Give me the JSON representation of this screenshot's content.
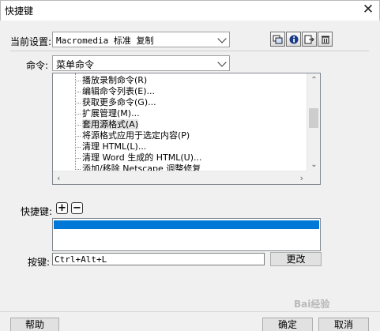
{
  "window": {
    "title": "快捷键",
    "close_glyph": "✕"
  },
  "current_set": {
    "label": "当前设置:",
    "value": "Macromedia 标准 复制"
  },
  "toolbar_icons": [
    "duplicate-set-icon",
    "info-icon",
    "export-html-icon",
    "delete-set-icon"
  ],
  "command": {
    "label": "命令:",
    "value": "菜单命令"
  },
  "tree": {
    "items": [
      "播放录制命令(R)",
      "编辑命令列表(E)...",
      "获取更多命令(G)...",
      "扩展管理(M)...",
      "套用源格式(A)",
      "将源格式应用于选定内容(P)",
      "清理 HTML(L)...",
      "清理 Word 生成的 HTML(U)...",
      "添加/移除 Netscape 调整修复"
    ],
    "selected_index": 4
  },
  "shortcuts": {
    "label": "快捷键:",
    "add_glyph": "+",
    "remove_glyph": "−"
  },
  "key": {
    "label": "按键:",
    "value": "Ctrl+Alt+L",
    "change_label": "更改"
  },
  "buttons": {
    "help": "帮助",
    "ok": "确定",
    "cancel": "取消"
  },
  "watermark": "Bai经验",
  "colors": {
    "selection": "#0078d7",
    "background": "#f0f0f0"
  }
}
